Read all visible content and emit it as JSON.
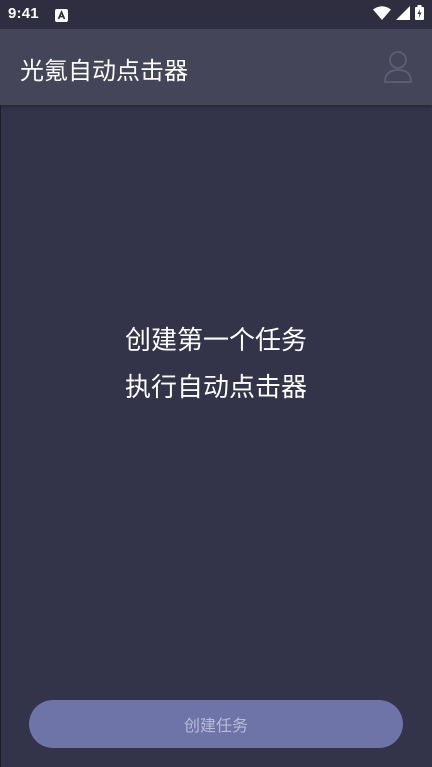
{
  "status_bar": {
    "time": "9:41",
    "icons": [
      "notification-a-icon",
      "wifi-icon",
      "signal-icon",
      "battery-icon"
    ]
  },
  "app_bar": {
    "title": "光氪自动点击器",
    "profile_icon": "user-profile-icon"
  },
  "empty_state": {
    "line1": "创建第一个任务",
    "line2": "执行自动点击器"
  },
  "actions": {
    "create_task_label": "创建任务"
  },
  "colors": {
    "background": "#33334a",
    "app_bar": "#45455a",
    "button": "#6e74a8",
    "button_text": "#b9bcd8"
  }
}
